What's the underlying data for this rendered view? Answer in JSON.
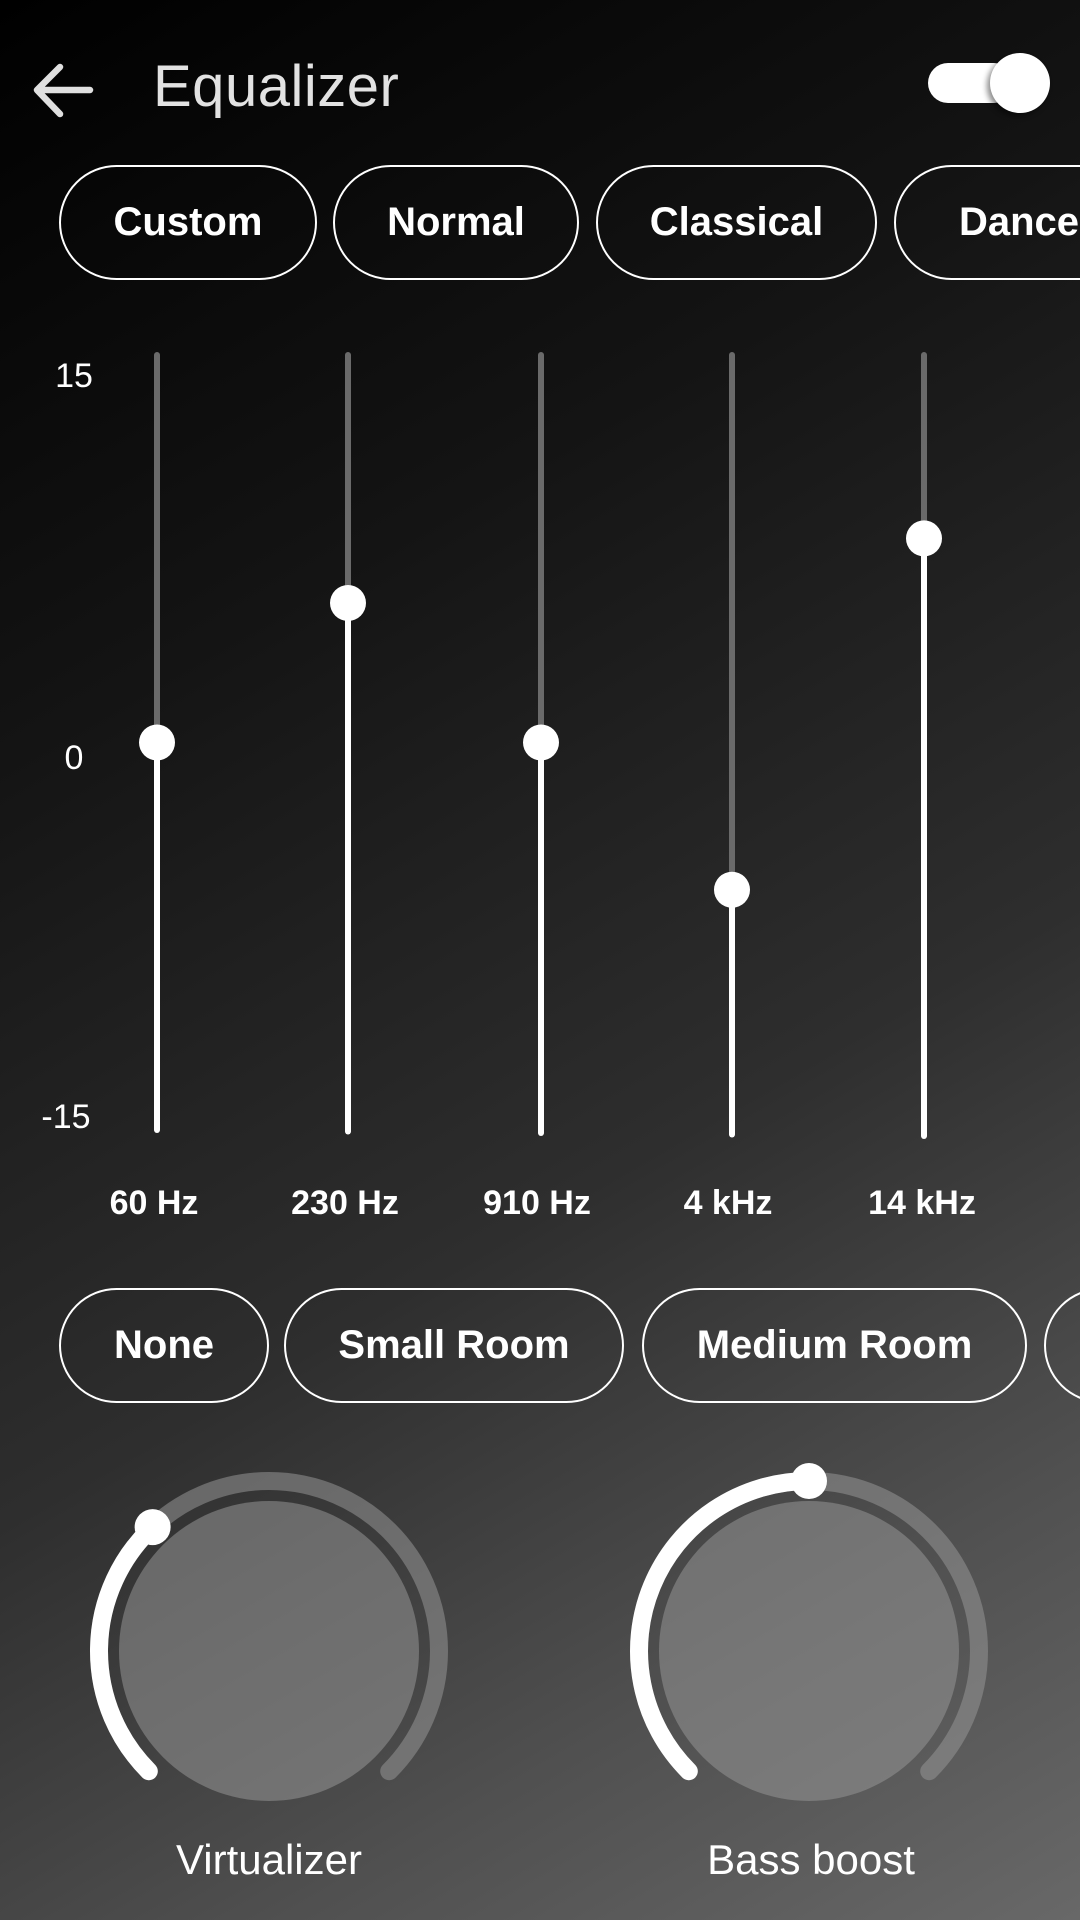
{
  "header": {
    "back_icon": "arrow-left-icon",
    "title": "Equalizer",
    "enabled": true
  },
  "presets": {
    "selected": "Custom",
    "items": [
      {
        "label": "Custom",
        "selected": true
      },
      {
        "label": "Normal",
        "selected": false
      },
      {
        "label": "Classical",
        "selected": false
      },
      {
        "label": "Dance",
        "selected": false
      }
    ]
  },
  "equalizer": {
    "axis": {
      "max_label": "15",
      "mid_label": "0",
      "min_label": "-15",
      "min": -15,
      "max": 15
    },
    "bands": [
      {
        "label": "60 Hz",
        "value": 0
      },
      {
        "label": "230 Hz",
        "value": 5.4
      },
      {
        "label": "910 Hz",
        "value": 0
      },
      {
        "label": "4 kHz",
        "value": -5.7
      },
      {
        "label": "14 kHz",
        "value": 7.9
      }
    ],
    "colors": {
      "active": "#ffffff",
      "inactive": "#6a6a6a",
      "thumb": "#ffffff"
    }
  },
  "reverb": {
    "selected": "None",
    "items": [
      {
        "label": "None",
        "selected": true
      },
      {
        "label": "Small Room",
        "selected": false
      },
      {
        "label": "Medium Room",
        "selected": false
      },
      {
        "label": "",
        "selected": false
      }
    ]
  },
  "knobs": [
    {
      "label": "Virtualizer",
      "value_percent": 34
    },
    {
      "label": "Bass boost",
      "value_percent": 50
    }
  ],
  "knob_colors": {
    "arc_active": "#ffffff",
    "arc_track": "rgba(150,150,150,0.55)",
    "dial": "rgba(150,150,150,0.55)"
  }
}
